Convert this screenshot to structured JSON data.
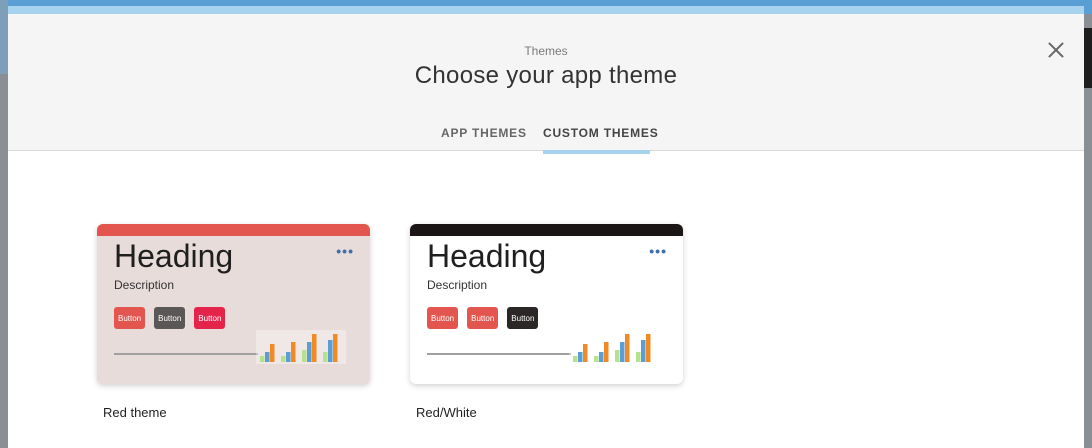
{
  "modal": {
    "subtitle": "Themes",
    "title": "Choose your app theme",
    "close_icon": "close-icon"
  },
  "tabs": [
    {
      "label": "APP THEMES",
      "active": false
    },
    {
      "label": "CUSTOM THEMES",
      "active": true
    }
  ],
  "themes": [
    {
      "name": "Red theme",
      "heading": "Heading",
      "description": "Description",
      "more": "•••",
      "top_color": "#e3564f",
      "buttons": [
        {
          "label": "Button",
          "color": "#e3564f"
        },
        {
          "label": "Button",
          "color": "#5b5756"
        },
        {
          "label": "Button",
          "color": "#e5244c"
        }
      ]
    },
    {
      "name": "Red/White",
      "heading": "Heading",
      "description": "Description",
      "more": "•••",
      "top_color": "#1b1515",
      "buttons": [
        {
          "label": "Button",
          "color": "#e3564f"
        },
        {
          "label": "Button",
          "color": "#e3564f"
        },
        {
          "label": "Button",
          "color": "#2b2727"
        }
      ]
    }
  ],
  "colors": {
    "accent": "#a7d3ee",
    "chart_green": "#b6e28f",
    "chart_blue": "#5b9ed6",
    "chart_orange": "#f08a24"
  }
}
